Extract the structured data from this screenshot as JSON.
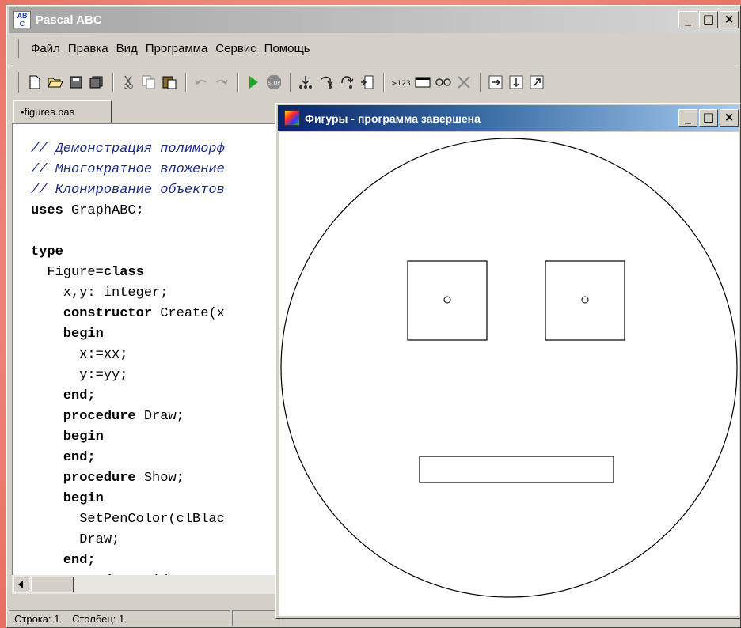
{
  "app": {
    "title": "Pascal ABC",
    "icon_letters": [
      "A",
      "B",
      "C"
    ]
  },
  "caption_buttons": [
    "_",
    "□",
    "×"
  ],
  "menu": [
    "Файл",
    "Правка",
    "Вид",
    "Программа",
    "Сервис",
    "Помощь"
  ],
  "toolbar_icons": [
    "new-file-icon",
    "open-folder-icon",
    "save-icon",
    "save-all-icon",
    "cut-icon",
    "copy-icon",
    "paste-icon",
    "undo-icon",
    "redo-icon",
    "run-icon",
    "stop-icon",
    "step-into-icon",
    "step-over-icon",
    "step-out-icon",
    "run-to-cursor-icon",
    "evaluate-icon",
    "window-icon",
    "watch-icon",
    "clear-icon",
    "add-watch-icon",
    "remove-watch-icon",
    "restore-icon"
  ],
  "editor": {
    "tab_label": "•figures.pas",
    "lines": [
      {
        "text": "// Демонстрация полиморф",
        "style": "comment"
      },
      {
        "text": "// Многократное вложение",
        "style": "comment"
      },
      {
        "text": "// Клонирование объектов",
        "style": "comment"
      },
      {
        "kw": "uses",
        "rest": " GraphABC;"
      },
      {
        "text": ""
      },
      {
        "kw": "type",
        "rest": ""
      },
      {
        "pre": "  Figure=",
        "kw": "class",
        "rest": ""
      },
      {
        "text": "    x,y: integer;"
      },
      {
        "pre": "    ",
        "kw": "constructor",
        "rest": " Create(x"
      },
      {
        "pre": "    ",
        "kw": "begin",
        "rest": ""
      },
      {
        "text": "      x:=xx;"
      },
      {
        "text": "      y:=yy;"
      },
      {
        "pre": "    ",
        "kw": "end;",
        "rest": ""
      },
      {
        "pre": "    ",
        "kw": "procedure",
        "rest": " Draw;"
      },
      {
        "pre": "    ",
        "kw": "begin",
        "rest": ""
      },
      {
        "pre": "    ",
        "kw": "end;",
        "rest": ""
      },
      {
        "pre": "    ",
        "kw": "procedure",
        "rest": " Show;"
      },
      {
        "pre": "    ",
        "kw": "begin",
        "rest": ""
      },
      {
        "text": "      SetPenColor(clBlac"
      },
      {
        "text": "      Draw;"
      },
      {
        "pre": "    ",
        "kw": "end;",
        "rest": ""
      },
      {
        "pre": "    ",
        "kw": "procedure",
        "rest": " Hide;"
      }
    ]
  },
  "status": {
    "row": "Строка: 1",
    "col": "Столбец: 1"
  },
  "child_window": {
    "title": "Фигуры - программа завершена"
  }
}
